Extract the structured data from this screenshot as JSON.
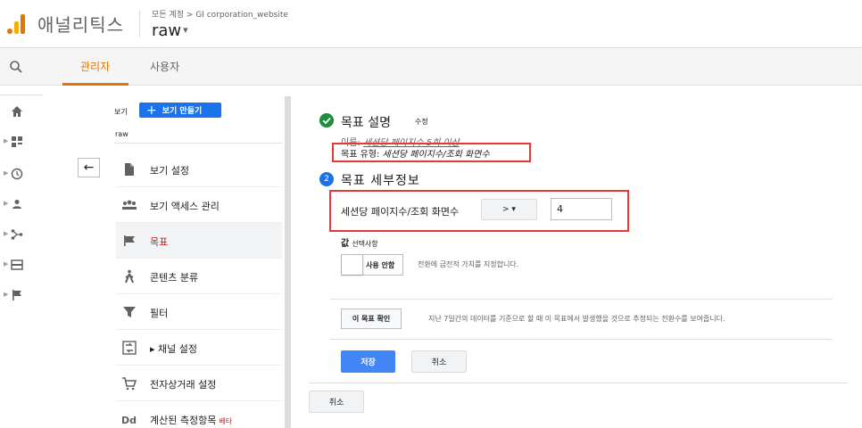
{
  "header": {
    "app_title": "애널리틱스",
    "breadcrumb": "모든 계정 > GI corporation_website",
    "view_name": "raw",
    "view_caret": "▾"
  },
  "tabs": {
    "admin": "관리자",
    "user": "사용자"
  },
  "admin_column": {
    "view_label": "보기",
    "create_view_label": "보기 만들기",
    "create_view_plus": "+",
    "current_view": "raw",
    "back_arrow": "←",
    "items": [
      {
        "label": "보기 설정",
        "icon": "document-icon"
      },
      {
        "label": "보기 액세스 관리",
        "icon": "people-icon"
      },
      {
        "label": "목표",
        "icon": "flag-icon",
        "active": true
      },
      {
        "label": "콘텐츠 분류",
        "icon": "person-walk-icon"
      },
      {
        "label": "필터",
        "icon": "filter-icon"
      },
      {
        "label": "▸ 채널 설정",
        "icon": "channel-icon"
      },
      {
        "label": "전자상거래 설정",
        "icon": "cart-icon"
      },
      {
        "label": "계산된 측정항목",
        "badge": "베타",
        "icon": "dd-icon"
      }
    ]
  },
  "goal": {
    "desc_title": "목표 설명",
    "edit_label": "수정",
    "name_prefix": "이름: ",
    "name_value": "세션당 페이지수 5회 이상",
    "type_prefix": "목표 유형: ",
    "type_value": "세션당 페이지수/조회 화면수",
    "step2_number": "2",
    "details_title": "목표 세부정보",
    "metric_label": "세션당 페이지수/조회 화면수",
    "operator": "> ▾",
    "value": "4",
    "value_heading": "값",
    "value_optional": "선택사항",
    "toggle_label": "사용 안함",
    "toggle_desc": "전환에 금전적 가치를 지정합니다.",
    "verify_label": "이 목표 확인",
    "verify_desc": "지난 7일간의 데이터를 기준으로 할 때 이 목표에서 발생했을 것으로 추정되는 전환수를 보여줍니다.",
    "save_label": "저장",
    "cancel_label": "취소",
    "outer_cancel_label": "취소"
  },
  "colors": {
    "accent_orange": "#e37400",
    "primary_blue": "#4285f4",
    "success_green": "#1e8e3e",
    "highlight_red": "#e53935"
  }
}
